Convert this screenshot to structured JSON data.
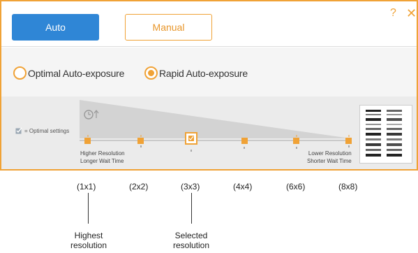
{
  "header": {
    "auto_label": "Auto",
    "manual_label": "Manual",
    "help_glyph": "?",
    "close_glyph": "✕"
  },
  "exposure": {
    "optimal_label": "Optimal Auto-exposure",
    "rapid_label": "Rapid Auto-exposure",
    "selected": "rapid"
  },
  "slider": {
    "legend": "= Optimal settings",
    "left_label_1": "Higher Resolution",
    "left_label_2": "Longer Wait Time",
    "right_label_1": "Lower Resolution",
    "right_label_2": "Shorter Wait Time",
    "stops": [
      "(1x1)",
      "(2x2)",
      "(3x3)",
      "(4x4)",
      "(6x6)",
      "(8x8)"
    ],
    "selected_index": 2
  },
  "callouts": {
    "highest": "Highest resolution",
    "selected": "Selected resolution"
  },
  "colors": {
    "accent": "#f0a236",
    "primary": "#2f86d6"
  }
}
